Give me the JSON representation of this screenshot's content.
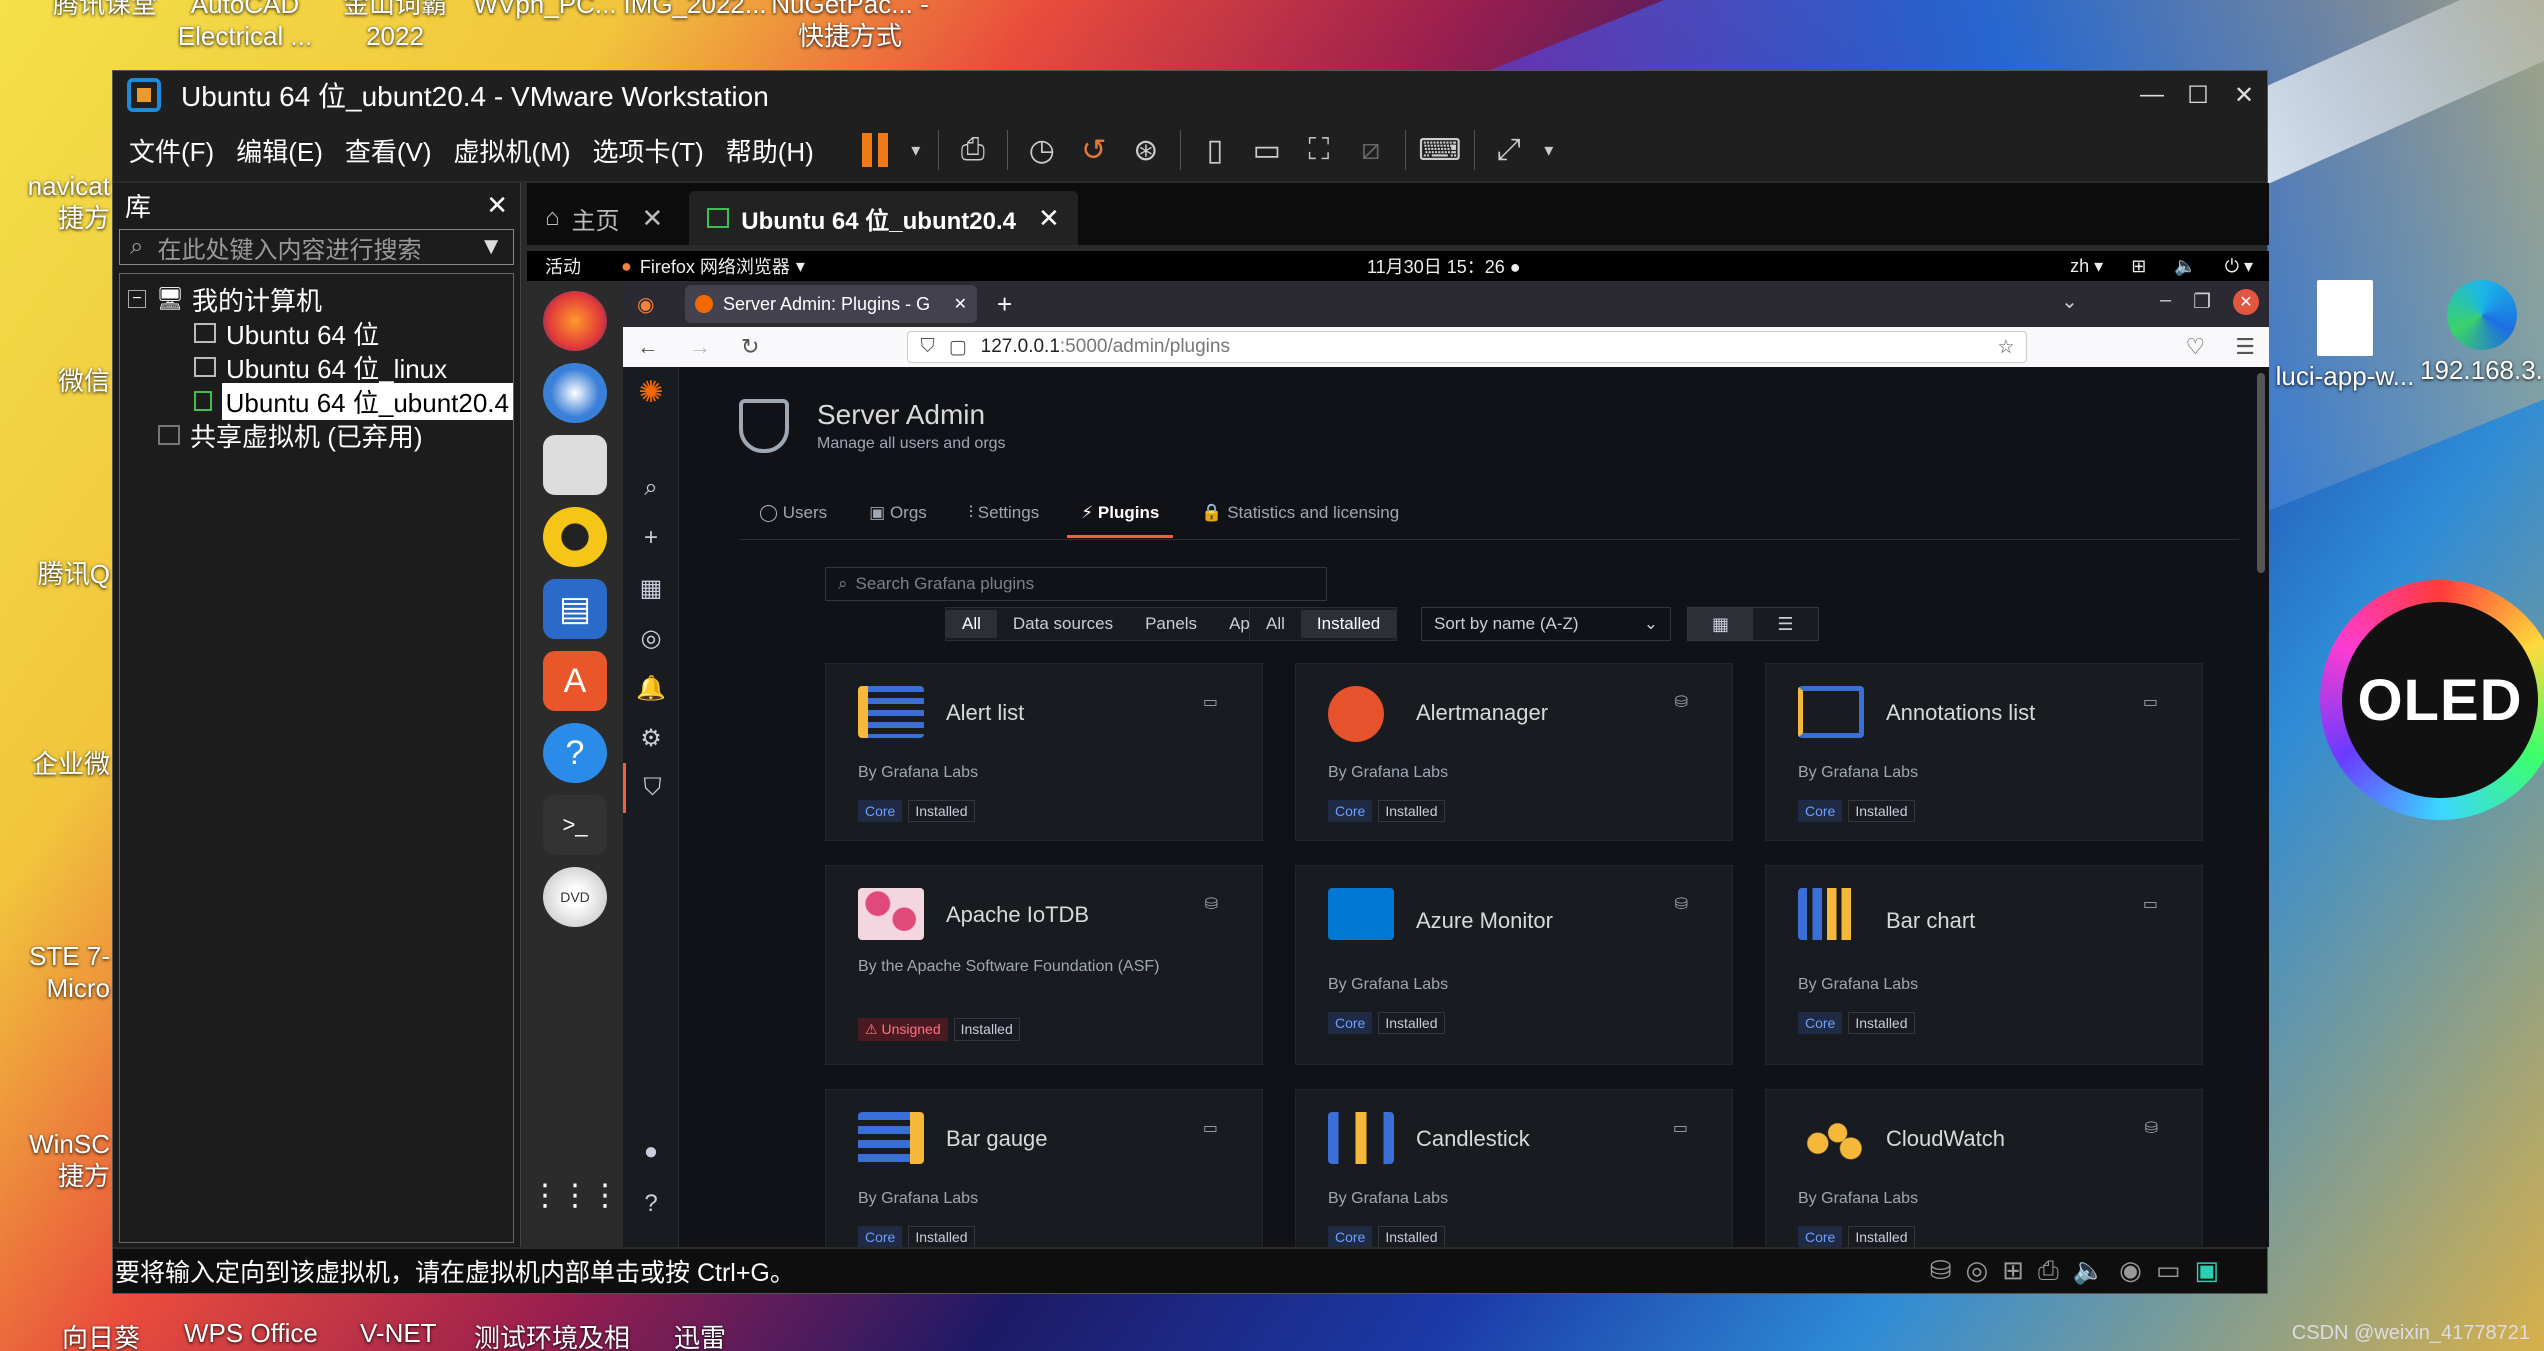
{
  "desktop": {
    "icons_left": [
      {
        "label": "腾讯课堂"
      },
      {
        "label": "AutoCAD Electrical ..."
      },
      {
        "label": "金山词霸 2022"
      },
      {
        "label": "WVph_PC..."
      },
      {
        "label": "IMG_2022..."
      },
      {
        "label": "NuGetPac... - 快捷方式"
      }
    ],
    "side_icons": [
      {
        "label": "navicat 捷方"
      },
      {
        "label": "微信"
      },
      {
        "label": "腾讯Q"
      },
      {
        "label": "企业微"
      },
      {
        "label": "STE 7-Micro"
      },
      {
        "label": "WinSC 捷方"
      }
    ],
    "right_icons": [
      {
        "label": "luci-app-w..."
      },
      {
        "label": "192.168.3."
      }
    ],
    "oled": "OLED",
    "watermark": "CSDN @weixin_41778721",
    "taskbar": [
      {
        "label": "向日葵"
      },
      {
        "label": "WPS Office"
      },
      {
        "label": "V-NET"
      },
      {
        "label": "测试环境及相"
      },
      {
        "label": "迅雷"
      }
    ]
  },
  "vmware": {
    "title": "Ubuntu 64 位_ubunt20.4 - VMware Workstation",
    "menu": [
      "文件(F)",
      "编辑(E)",
      "查看(V)",
      "虚拟机(M)",
      "选项卡(T)",
      "帮助(H)"
    ],
    "library": {
      "title": "库",
      "search_placeholder": "在此处键入内容进行搜索",
      "root": "我的计算机",
      "vms": [
        "Ubuntu 64 位",
        "Ubuntu 64 位_linux",
        "Ubuntu 64 位_ubunt20.4"
      ],
      "shared": "共享虚拟机 (已弃用)"
    },
    "tabs": [
      {
        "label": "主页"
      },
      {
        "label": "Ubuntu 64 位_ubunt20.4"
      }
    ],
    "status_text": "要将输入定向到该虚拟机，请在虚拟机内部单击或按 Ctrl+G。"
  },
  "ubuntu": {
    "activities": "活动",
    "app_menu": "Firefox 网络浏览器",
    "clock": "11月30日  15：26",
    "lang": "zh"
  },
  "firefox": {
    "tab_title": "Server Admin: Plugins - G",
    "url_host": "127.0.0.1",
    "url_path": ":5000/admin/plugins"
  },
  "grafana": {
    "page_title": "Server Admin",
    "page_subtitle": "Manage all users and orgs",
    "tabs": [
      "Users",
      "Orgs",
      "Settings",
      "Plugins",
      "Statistics and licensing"
    ],
    "active_tab": "Plugins",
    "search_placeholder": "Search Grafana plugins",
    "type_filters": [
      "All",
      "Data sources",
      "Panels",
      "Applications"
    ],
    "state_filters": [
      "All",
      "Installed"
    ],
    "sort": "Sort by name (A-Z)",
    "plugins": [
      {
        "name": "Alert list",
        "by": "By Grafana Labs",
        "badge": "Core",
        "status": "Installed",
        "cat_icon": "panel-icon"
      },
      {
        "name": "Alertmanager",
        "by": "By Grafana Labs",
        "badge": "Core",
        "status": "Installed",
        "cat_icon": "datasource-icon"
      },
      {
        "name": "Annotations list",
        "by": "By Grafana Labs",
        "badge": "Core",
        "status": "Installed",
        "cat_icon": "panel-icon"
      },
      {
        "name": "Apache IoTDB",
        "by": "By the Apache Software Foundation (ASF)",
        "badge": "Unsigned",
        "status": "Installed",
        "cat_icon": "datasource-icon"
      },
      {
        "name": "Azure Monitor",
        "by": "By Grafana Labs",
        "badge": "Core",
        "status": "Installed",
        "cat_icon": "datasource-icon"
      },
      {
        "name": "Bar chart",
        "by": "By Grafana Labs",
        "badge": "Core",
        "status": "Installed",
        "cat_icon": "panel-icon"
      },
      {
        "name": "Bar gauge",
        "by": "By Grafana Labs",
        "badge": "Core",
        "status": "Installed",
        "cat_icon": "panel-icon"
      },
      {
        "name": "Candlestick",
        "by": "By Grafana Labs",
        "badge": "Core",
        "status": "Installed",
        "cat_icon": "panel-icon"
      },
      {
        "name": "CloudWatch",
        "by": "By Grafana Labs",
        "badge": "Core",
        "status": "Installed",
        "cat_icon": "datasource-icon"
      }
    ]
  },
  "colors": {
    "vmware_accent": "#f07a1a",
    "grafana_bg": "#111217",
    "grafana_card": "#181b1f",
    "grafana_accent": "#f55f3e",
    "core_badge": "#6e9fff",
    "unsigned_badge": "#ff7383"
  }
}
